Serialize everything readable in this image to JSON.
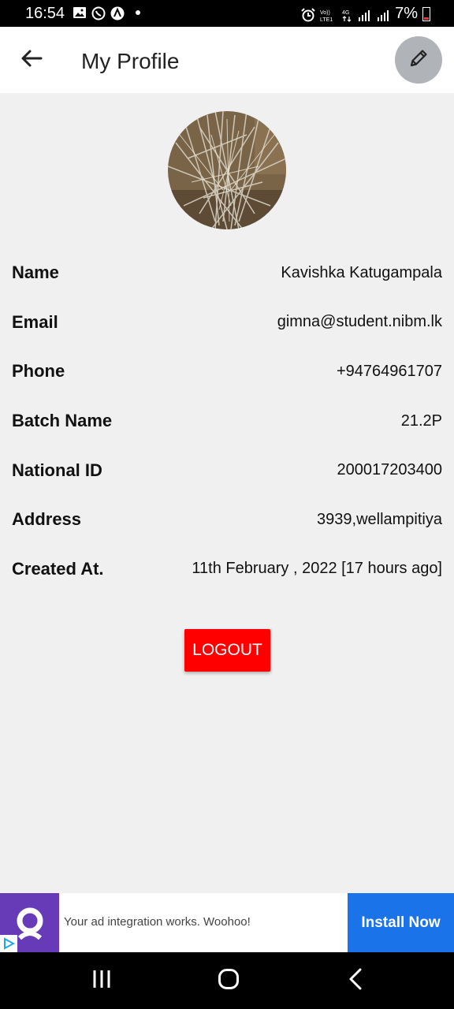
{
  "status_bar": {
    "time": "16:54",
    "battery": "7%",
    "icons": [
      "image-icon",
      "whatsapp-icon",
      "app-icon",
      "alarm-icon",
      "volte-icon",
      "4g-icon",
      "signal-icon",
      "signal-icon",
      "battery-icon"
    ],
    "network_label_top": "4G"
  },
  "app_bar": {
    "title": "My Profile",
    "back_icon": "arrow-left-icon",
    "edit_icon": "pencil-icon"
  },
  "profile": {
    "fields": [
      {
        "label": "Name",
        "value": "Kavishka Katugampala"
      },
      {
        "label": "Email",
        "value": "gimna@student.nibm.lk"
      },
      {
        "label": "Phone",
        "value": "+94764961707"
      },
      {
        "label": "Batch Name",
        "value": "21.2P"
      },
      {
        "label": "National ID",
        "value": "200017203400"
      },
      {
        "label": "Address",
        "value": "3939,wellampitiya"
      },
      {
        "label": "Created At.",
        "value": "11th February , 2022 [17 hours ago]"
      }
    ]
  },
  "logout": {
    "label": "LOGOUT",
    "color": "#fe0000"
  },
  "ad": {
    "text": "Your ad integration works. Woohoo!",
    "cta": "Install Now",
    "cta_color": "#1a73e8",
    "logo_color": "#673ab7"
  },
  "nav": {
    "icons": [
      "recents-icon",
      "home-icon",
      "back-icon"
    ]
  }
}
